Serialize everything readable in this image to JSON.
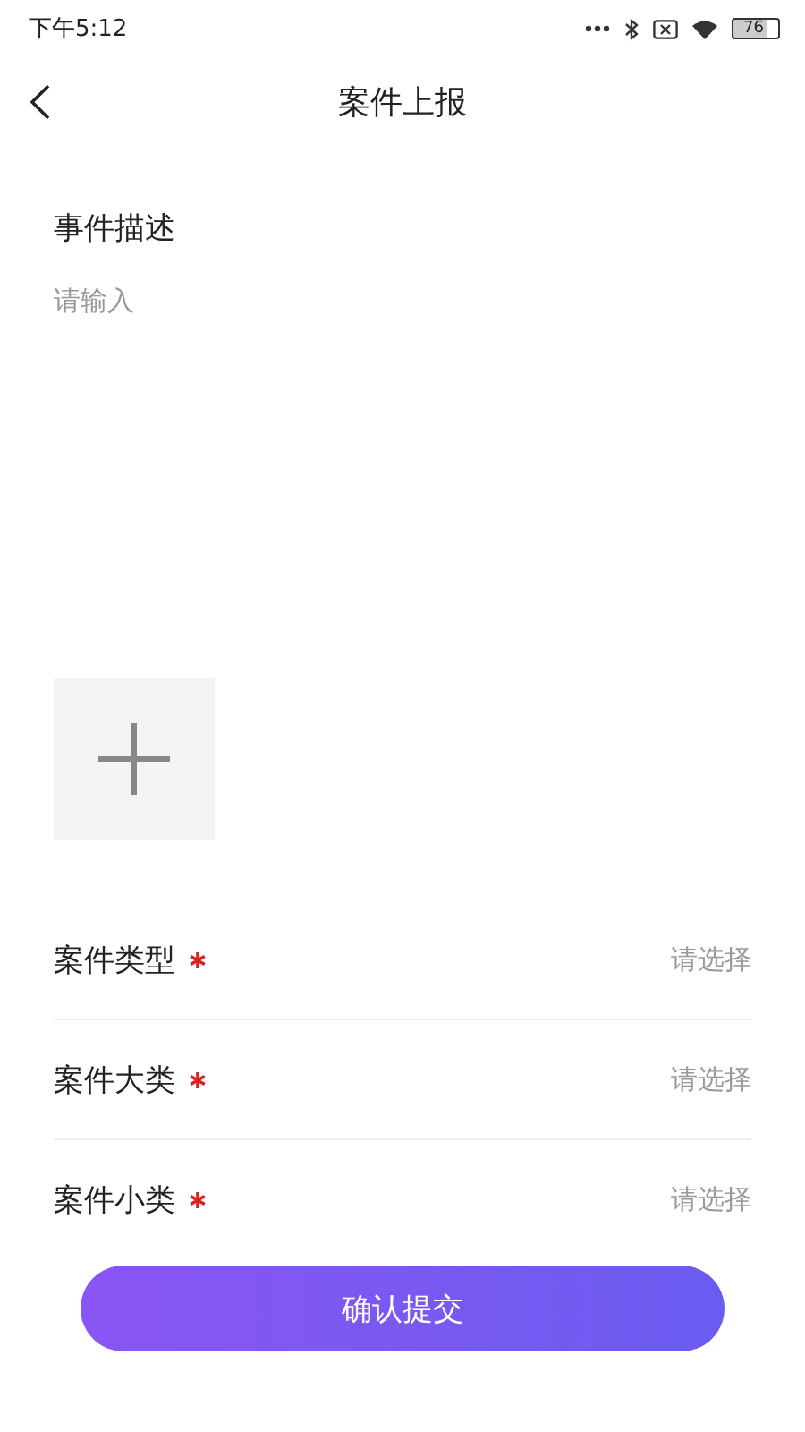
{
  "status_bar": {
    "time": "下午5:12",
    "battery": "76"
  },
  "header": {
    "title": "案件上报"
  },
  "description": {
    "label": "事件描述",
    "placeholder": "请输入"
  },
  "fields": [
    {
      "label": "案件类型",
      "required": true,
      "placeholder": "请选择"
    },
    {
      "label": "案件大类",
      "required": true,
      "placeholder": "请选择"
    },
    {
      "label": "案件小类",
      "required": true,
      "placeholder": "请选择"
    }
  ],
  "submit": "确认提交"
}
